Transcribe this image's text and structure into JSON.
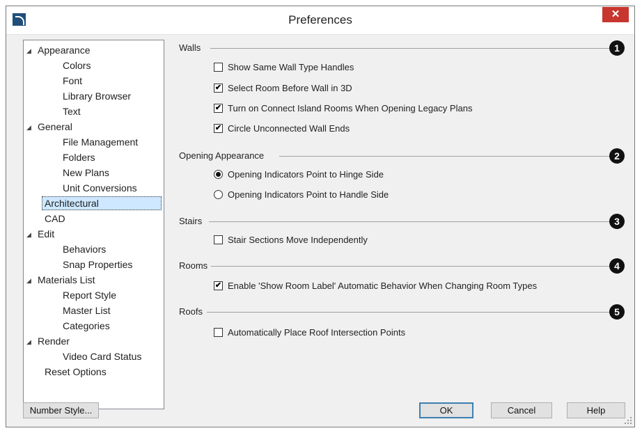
{
  "window": {
    "title": "Preferences",
    "close_symbol": "✕"
  },
  "tree": {
    "items": [
      {
        "label": "Appearance",
        "expanded": true,
        "level": 0
      },
      {
        "label": "Colors",
        "level": 1
      },
      {
        "label": "Font",
        "level": 1
      },
      {
        "label": "Library Browser",
        "level": 1
      },
      {
        "label": "Text",
        "level": 1
      },
      {
        "label": "General",
        "expanded": true,
        "level": 0
      },
      {
        "label": "File Management",
        "level": 1
      },
      {
        "label": "Folders",
        "level": 1
      },
      {
        "label": "New Plans",
        "level": 1
      },
      {
        "label": "Unit Conversions",
        "level": 1
      },
      {
        "label": "Architectural",
        "level": 0,
        "selected": true
      },
      {
        "label": "CAD",
        "level": 0
      },
      {
        "label": "Edit",
        "expanded": true,
        "level": 0
      },
      {
        "label": "Behaviors",
        "level": 1
      },
      {
        "label": "Snap Properties",
        "level": 1
      },
      {
        "label": "Materials List",
        "expanded": true,
        "level": 0
      },
      {
        "label": "Report Style",
        "level": 1
      },
      {
        "label": "Master List",
        "level": 1
      },
      {
        "label": "Categories",
        "level": 1
      },
      {
        "label": "Render",
        "expanded": true,
        "level": 0
      },
      {
        "label": "Video Card Status",
        "level": 1
      },
      {
        "label": "Reset Options",
        "level": 0
      }
    ]
  },
  "sections": {
    "walls": {
      "label": "Walls",
      "badge": "1",
      "options": [
        {
          "label": "Show Same Wall Type Handles",
          "checked": false
        },
        {
          "label": "Select Room Before Wall in 3D",
          "checked": true
        },
        {
          "label": "Turn on Connect Island Rooms When Opening Legacy Plans",
          "checked": true
        },
        {
          "label": "Circle Unconnected Wall Ends",
          "checked": true
        }
      ]
    },
    "opening": {
      "label": "Opening Appearance",
      "badge": "2",
      "options": [
        {
          "label": "Opening Indicators Point to Hinge Side",
          "selected": true
        },
        {
          "label": "Opening Indicators Point to Handle Side",
          "selected": false
        }
      ]
    },
    "stairs": {
      "label": "Stairs",
      "badge": "3",
      "options": [
        {
          "label": "Stair Sections Move Independently",
          "checked": false
        }
      ]
    },
    "rooms": {
      "label": "Rooms",
      "badge": "4",
      "options": [
        {
          "label": "Enable 'Show Room Label' Automatic Behavior When Changing Room Types",
          "checked": true
        }
      ]
    },
    "roofs": {
      "label": "Roofs",
      "badge": "5",
      "options": [
        {
          "label": "Automatically Place Roof Intersection Points",
          "checked": false
        }
      ]
    }
  },
  "buttons": {
    "number_style": "Number Style...",
    "ok": "OK",
    "cancel": "Cancel",
    "help": "Help"
  },
  "colors": {
    "close_button": "#c7372f",
    "selection": "#cde8ff",
    "badge": "#111111"
  },
  "icons": {
    "expand_arrow": "◢",
    "checkmark": "✔"
  }
}
